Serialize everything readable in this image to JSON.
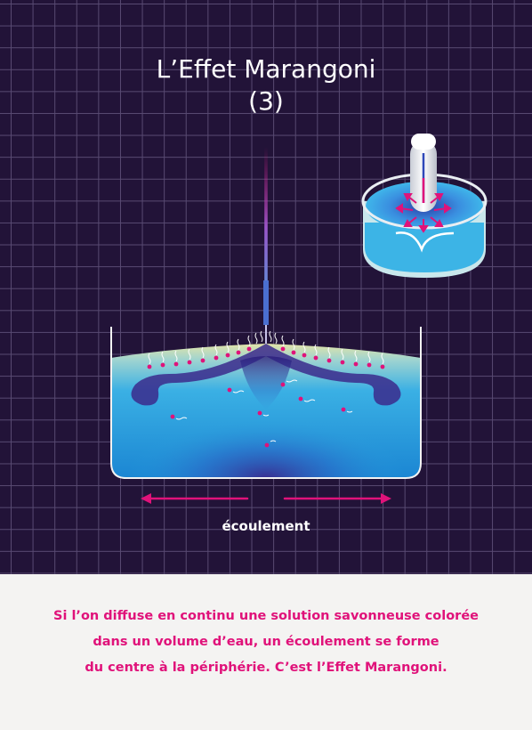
{
  "title": {
    "line1": "L’Effet Marangoni",
    "line2": "(3)"
  },
  "diagram": {
    "flow_label": "écoulement"
  },
  "caption": {
    "line1": "Si l’on diffuse en continu une solution savonneuse colorée",
    "line2": "dans un volume d’eau, un écoulement se forme",
    "line3": "du centre à la périphérie. C’est l’Effet Marangoni."
  },
  "colors": {
    "background": "#221338",
    "accent": "#e0127a",
    "water": "#2aa6e0",
    "surface": "#e2e3a8",
    "dye": "#3b2a8c",
    "caption_bg": "#f4f3f2"
  },
  "icons": [
    "dropper-needle-icon",
    "petri-dish-icon",
    "flow-arrow-icon"
  ]
}
